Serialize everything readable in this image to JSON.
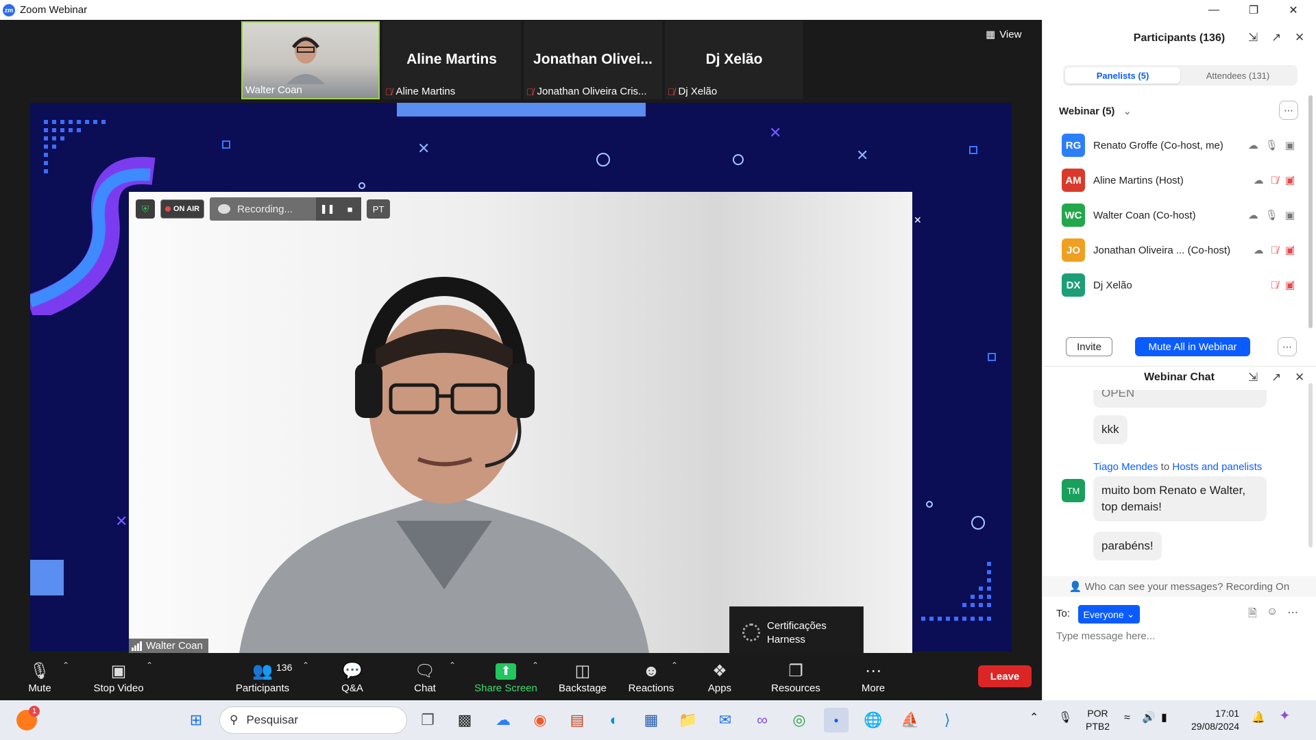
{
  "window": {
    "app_title": "Zoom Webinar",
    "logo": "zm"
  },
  "thumbnails": [
    {
      "big_name": "",
      "label": "Walter Coan",
      "muted": false,
      "active": true
    },
    {
      "big_name": "Aline Martins",
      "label": "Aline Martins",
      "muted": true,
      "active": false
    },
    {
      "big_name": "Jonathan  Olivei...",
      "label": "Jonathan Oliveira Cris...",
      "muted": true,
      "active": false
    },
    {
      "big_name": "Dj Xelão",
      "label": "Dj Xelão",
      "muted": true,
      "active": false
    }
  ],
  "view_button": "View",
  "main_video": {
    "on_air": "ON AIR",
    "recording": "Recording...",
    "pt_badge": "PT",
    "name": "Walter Coan"
  },
  "tooltip": {
    "line1": "Certificações",
    "line2": "Harness"
  },
  "toolbar": {
    "mute": "Mute",
    "stop_video": "Stop Video",
    "participants": "Participants",
    "participants_count": "136",
    "qa": "Q&A",
    "chat": "Chat",
    "share_screen": "Share Screen",
    "backstage": "Backstage",
    "reactions": "Reactions",
    "apps": "Apps",
    "resources": "Resources",
    "more": "More",
    "leave": "Leave"
  },
  "participants_panel": {
    "title": "Participants (136)",
    "tab_panelists": "Panelists (5)",
    "tab_attendees": "Attendees (131)",
    "group": "Webinar (5)",
    "people": [
      {
        "initials": "RG",
        "name": "Renato Groffe (Co-host, me)",
        "color": "#2d7ff9",
        "mic_muted": false,
        "video_off": false,
        "cloud": true
      },
      {
        "initials": "AM",
        "name": "Aline Martins (Host)",
        "color": "#d93a2b",
        "mic_muted": true,
        "video_off": true,
        "cloud": true
      },
      {
        "initials": "WC",
        "name": "Walter Coan (Co-host)",
        "color": "#22a84a",
        "mic_muted": false,
        "video_off": false,
        "cloud": true
      },
      {
        "initials": "JO",
        "name": "Jonathan Oliveira ... (Co-host)",
        "color": "#f0a020",
        "mic_muted": true,
        "video_off": true,
        "cloud": true
      },
      {
        "initials": "DX",
        "name": "Dj Xelão",
        "color": "#1d9e78",
        "mic_muted": true,
        "video_off": true,
        "cloud": false
      }
    ],
    "invite": "Invite",
    "mute_all": "Mute All in Webinar"
  },
  "chat_panel": {
    "title": "Webinar Chat",
    "partial_message": "OPEN",
    "msg_kkk": "kkk",
    "sender_name": "Tiago Mendes",
    "sender_to": "to",
    "sender_target": "Hosts and panelists",
    "sender_initials": "TM",
    "msg1": "muito bom Renato e Walter, top demais!",
    "msg2": "parabéns!",
    "visibility_note": "Who can see your messages? Recording On",
    "to_label": "To:",
    "recipient": "Everyone",
    "placeholder": "Type message here..."
  },
  "taskbar": {
    "search_placeholder": "Pesquisar",
    "notification_badge": "1",
    "lang_line1": "POR",
    "lang_line2": "PTB2",
    "time": "17:01",
    "date": "29/08/2024"
  }
}
